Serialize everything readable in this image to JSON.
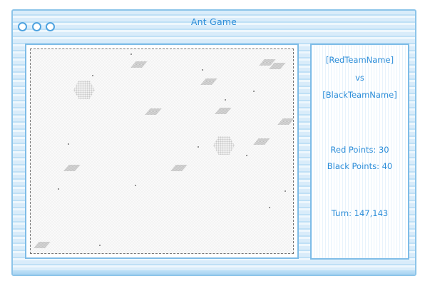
{
  "window": {
    "title": "Ant Game",
    "controls": [
      "close-button",
      "minimize-button",
      "maximize-button"
    ]
  },
  "info_panel": {
    "red_team_name": "[RedTeamName]",
    "vs_label": "vs",
    "black_team_name": "[BlackTeamName]",
    "red_points": "Red Points: 30",
    "black_points": "Black Points: 40",
    "turn": "Turn: 147,143"
  },
  "colors": {
    "accent": "#2d8ed9",
    "frame": "#8cc4e9",
    "rock": "#b5b5b5",
    "board": "#fafafa"
  }
}
